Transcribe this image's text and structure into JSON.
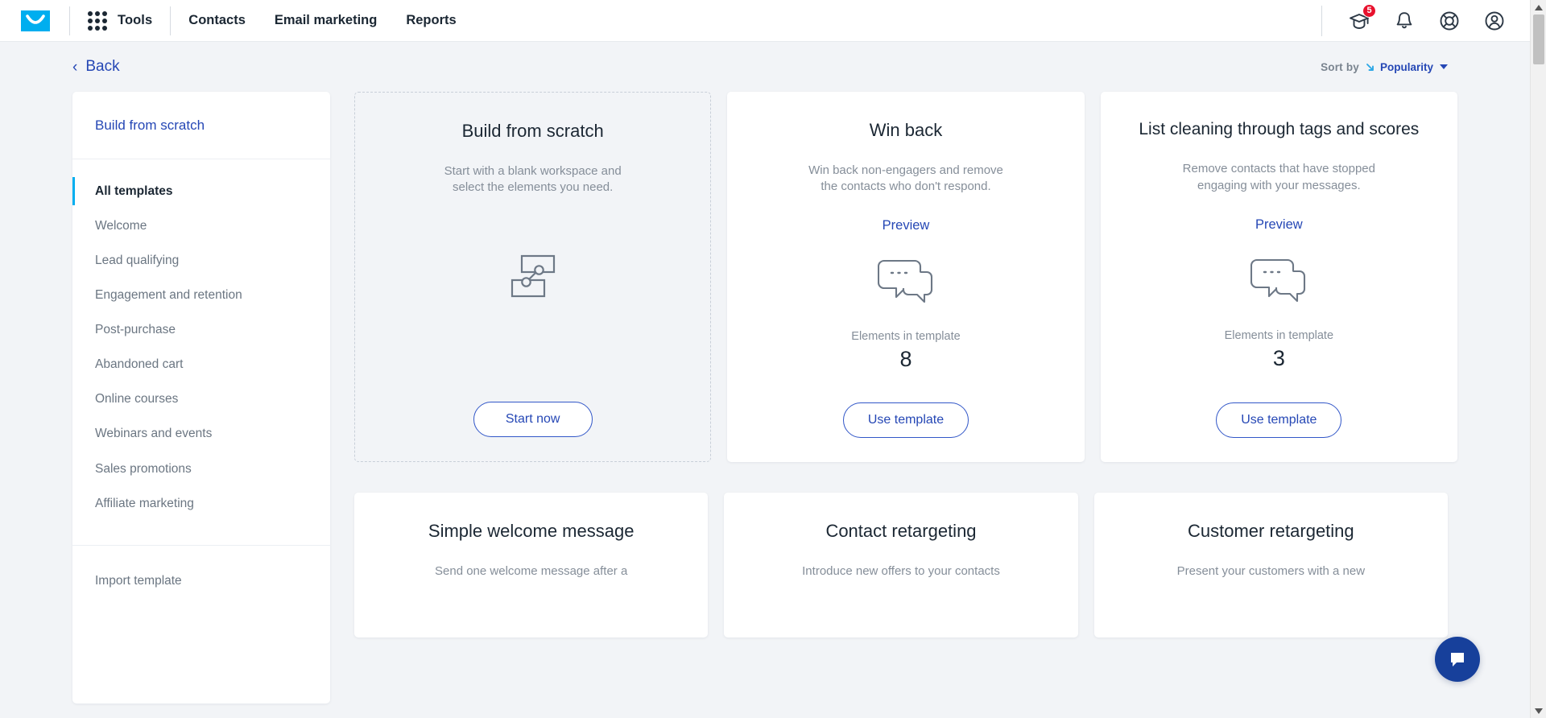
{
  "topnav": {
    "logo_icon": "envelope-logo-icon",
    "apps_icon": "apps-grid-icon",
    "tools_label": "Tools",
    "links": [
      {
        "label": "Contacts"
      },
      {
        "label": "Email marketing"
      },
      {
        "label": "Reports"
      }
    ],
    "right_icons": [
      {
        "name": "graduation-cap-icon",
        "badge": "5"
      },
      {
        "name": "bell-icon",
        "badge": ""
      },
      {
        "name": "lifebuoy-help-icon",
        "badge": ""
      },
      {
        "name": "user-account-icon",
        "badge": ""
      }
    ]
  },
  "page_head": {
    "back_label": "Back",
    "back_chevron": "‹",
    "sort_label": "Sort by",
    "sort_value": "Popularity",
    "sort_arrow_icon": "sort-arrow-icon",
    "caret_icon": "chevron-down-icon"
  },
  "sidebar": {
    "build_from_scratch": "Build from scratch",
    "items": [
      {
        "label": "All templates",
        "active": true
      },
      {
        "label": "Welcome",
        "active": false
      },
      {
        "label": "Lead qualifying",
        "active": false
      },
      {
        "label": "Engagement and retention",
        "active": false
      },
      {
        "label": "Post-purchase",
        "active": false
      },
      {
        "label": "Abandoned cart",
        "active": false
      },
      {
        "label": "Online courses",
        "active": false
      },
      {
        "label": "Webinars and events",
        "active": false
      },
      {
        "label": "Sales promotions",
        "active": false
      },
      {
        "label": "Affiliate marketing",
        "active": false
      }
    ],
    "import_template": "Import template"
  },
  "cards": [
    {
      "kind": "scratch",
      "title": "Build from scratch",
      "description": "Start with a blank workspace and select the elements you need.",
      "icon": "workflow-diagram-icon",
      "button": "Start now"
    },
    {
      "kind": "template",
      "title": "Win back",
      "description": "Win back non-engagers and remove the contacts who don't respond.",
      "preview": "Preview",
      "icon": "chat-bubbles-icon",
      "elements_label": "Elements in template",
      "elements_count": "8",
      "button": "Use template"
    },
    {
      "kind": "template",
      "title": "List cleaning through tags and scores",
      "description": "Remove contacts that have stopped engaging with your messages.",
      "preview": "Preview",
      "icon": "chat-bubbles-icon",
      "elements_label": "Elements in template",
      "elements_count": "3",
      "button": "Use template"
    }
  ],
  "cards_row2": [
    {
      "title": "Simple welcome message",
      "description": "Send one welcome message after a"
    },
    {
      "title": "Contact retargeting",
      "description": "Introduce new offers to your contacts"
    },
    {
      "title": "Customer retargeting",
      "description": "Present your customers with a new"
    }
  ],
  "chat": {
    "icon": "chat-bubble-icon"
  },
  "scrollbar": {
    "up_icon": "scroll-up-arrow-icon",
    "down_icon": "scroll-down-arrow-icon"
  },
  "colors": {
    "brand_cyan": "#00aeef",
    "link_blue": "#2547b5",
    "badge_red": "#e8112d",
    "text_dark": "#1b2733",
    "text_muted": "#858e99",
    "page_bg": "#f2f4f7"
  }
}
